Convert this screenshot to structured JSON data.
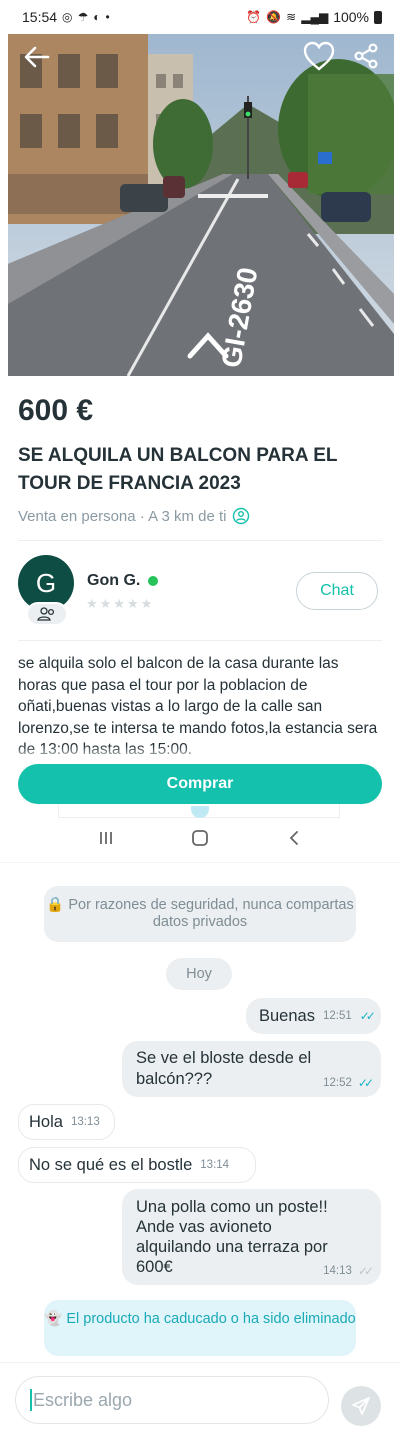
{
  "status_bar": {
    "time": "15:54",
    "battery": "100%"
  },
  "listing": {
    "price": "600 €",
    "title": "SE ALQUILA UN BALCON PARA EL TOUR DE FRANCIA 2023",
    "meta": "Venta en persona · A 3 km de ti",
    "photo_overlay_text": "GI-2630",
    "description": "se alquila solo el balcon de la casa durante las horas que pasa el tour por la poblacion de oñati,buenas vistas a lo largo de la calle san lorenzo,se te intersa te mando fotos,la estancia sera de 13:00 hasta las 15:00."
  },
  "seller": {
    "initial": "G",
    "name": "Gon G.",
    "rating_stars": "★★★★★",
    "rating": 0,
    "chat_label": "Chat"
  },
  "actions": {
    "buy_label": "Comprar"
  },
  "chat": {
    "security_notice": "Por razones de seguridad, nunca compartas datos privados",
    "day_label": "Hoy",
    "messages": [
      {
        "direction": "out",
        "text": "Buenas",
        "time": "12:51",
        "read": true
      },
      {
        "direction": "out",
        "text": "Se ve el bloste desde el balcón???",
        "time": "12:52",
        "read": true
      },
      {
        "direction": "in",
        "text": "Hola",
        "time": "13:13"
      },
      {
        "direction": "in",
        "text": "No se qué es el bostle",
        "time": "13:14"
      },
      {
        "direction": "out",
        "text": "Una polla como un poste!! Ande vas avioneto alquilando una terraza por 600€",
        "time": "14:13",
        "read": false
      }
    ],
    "expired_notice": "El producto ha caducado o ha sido eliminado",
    "composer_placeholder": "Escribe algo"
  },
  "colors": {
    "accent": "#13c1ac",
    "text": "#253238",
    "muted": "#8a9aa3",
    "avatar": "#0e4d43"
  }
}
